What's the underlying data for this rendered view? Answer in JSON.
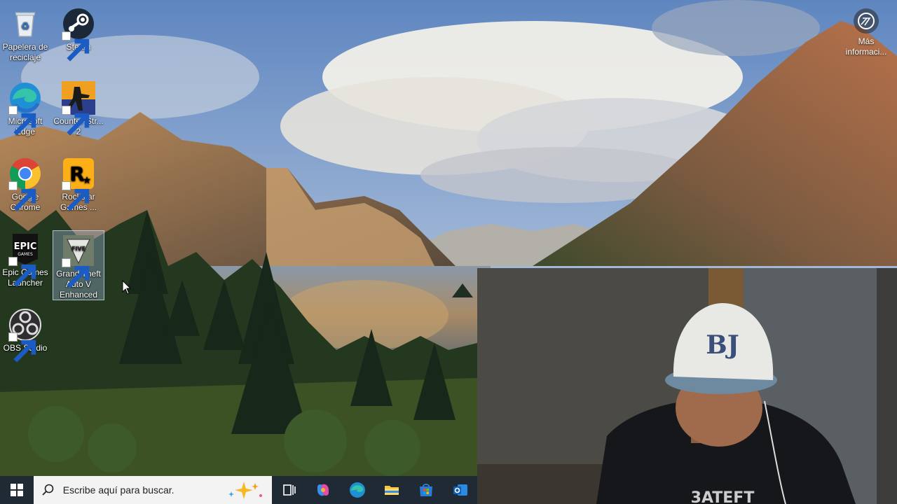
{
  "desktop": {
    "icons": [
      {
        "label": "Papelera de reciclaje",
        "icon": "recycle-bin-icon"
      },
      {
        "label": "Steam",
        "icon": "steam-icon"
      },
      {
        "label": "Microsoft Edge",
        "icon": "edge-icon"
      },
      {
        "label": "Counter-Str... 2",
        "icon": "counter-strike-icon"
      },
      {
        "label": "Google Chrome",
        "icon": "chrome-icon"
      },
      {
        "label": "Rockstar Games ...",
        "icon": "rockstar-icon"
      },
      {
        "label": "Epic Games Launcher",
        "icon": "epic-games-icon"
      },
      {
        "label": "Grand Theft Auto V Enhanced",
        "icon": "gta-v-icon"
      },
      {
        "label": "OBS Studio",
        "icon": "obs-icon"
      }
    ],
    "more_info": {
      "label": "Más informaci...",
      "icon": "more-info-icon"
    }
  },
  "taskbar": {
    "search": {
      "placeholder": "Escribe aquí para buscar."
    },
    "buttons": [
      {
        "name": "task-view",
        "icon": "task-view-icon"
      },
      {
        "name": "copilot",
        "icon": "copilot-icon"
      },
      {
        "name": "edge",
        "icon": "edge-icon"
      },
      {
        "name": "file-explorer",
        "icon": "folder-icon"
      },
      {
        "name": "microsoft-store",
        "icon": "store-icon"
      },
      {
        "name": "outlook",
        "icon": "outlook-icon"
      }
    ]
  },
  "colors": {
    "taskbar": "#1f2a34",
    "search_bg": "#f3f3f3",
    "sky": "#7e9cc4",
    "lake": "#7d8fa0"
  }
}
